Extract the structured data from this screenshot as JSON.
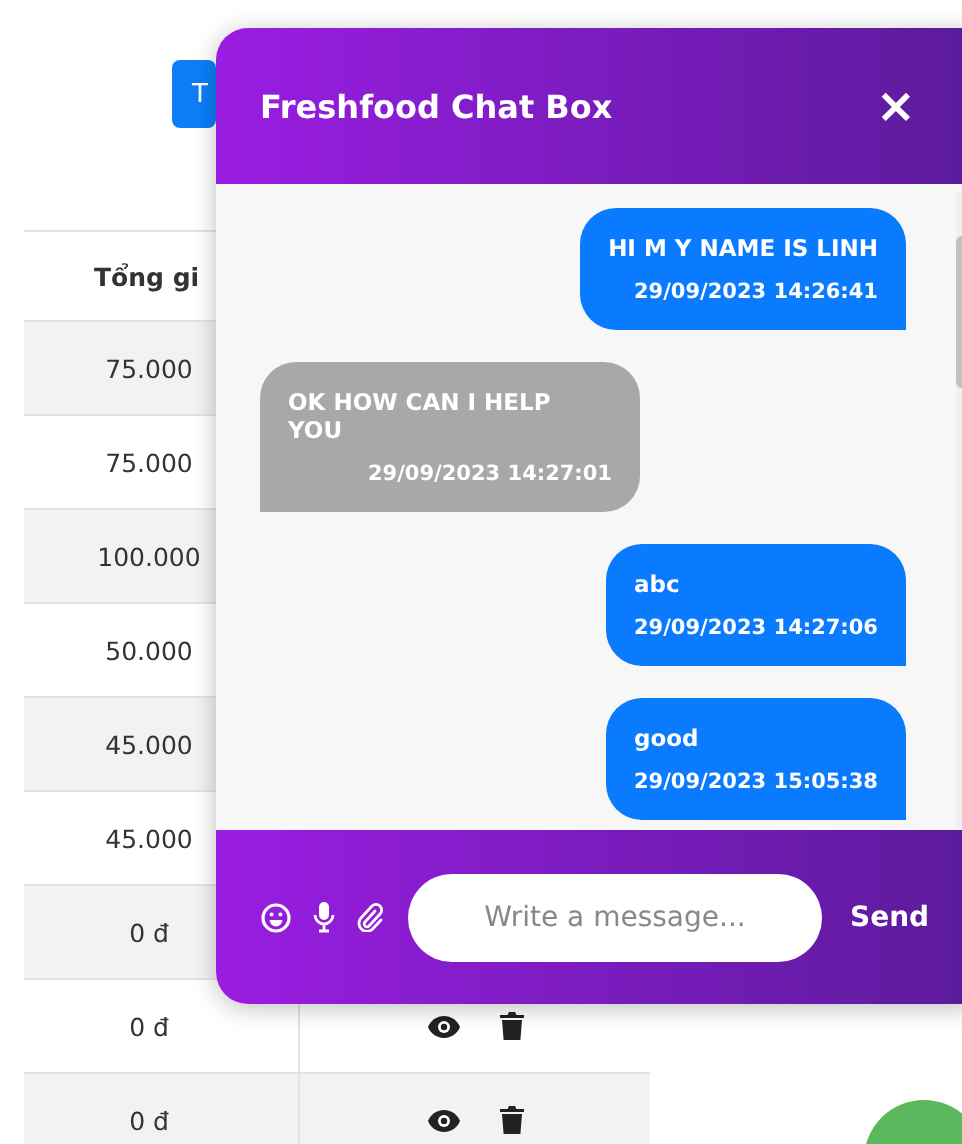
{
  "page": {
    "top_button": "T",
    "table": {
      "columns": [
        "Tổng gi"
      ],
      "rows": [
        {
          "total": "75.000",
          "has_actions": false
        },
        {
          "total": "75.000",
          "has_actions": false
        },
        {
          "total": "100.000",
          "has_actions": false
        },
        {
          "total": "50.000",
          "has_actions": false
        },
        {
          "total": "45.000",
          "has_actions": false
        },
        {
          "total": "45.000",
          "has_actions": false
        },
        {
          "total": "0 đ",
          "has_actions": false
        },
        {
          "total": "0 đ",
          "has_actions": true
        },
        {
          "total": "0 đ",
          "has_actions": true
        }
      ]
    }
  },
  "chat": {
    "title": "Freshfood Chat Box",
    "close": "×",
    "messages": [
      {
        "kind": "sent",
        "text": "HI M Y NAME IS LINH",
        "time": "29/09/2023 14:26:41"
      },
      {
        "kind": "received",
        "text": "OK HOW CAN I HELP YOU",
        "time": "29/09/2023 14:27:01"
      },
      {
        "kind": "sent",
        "text": "abc",
        "time": "29/09/2023 14:27:06"
      },
      {
        "kind": "sent",
        "text": "good",
        "time": "29/09/2023 15:05:38"
      }
    ],
    "input": {
      "placeholder": "Write a message..."
    },
    "send": "Send"
  }
}
